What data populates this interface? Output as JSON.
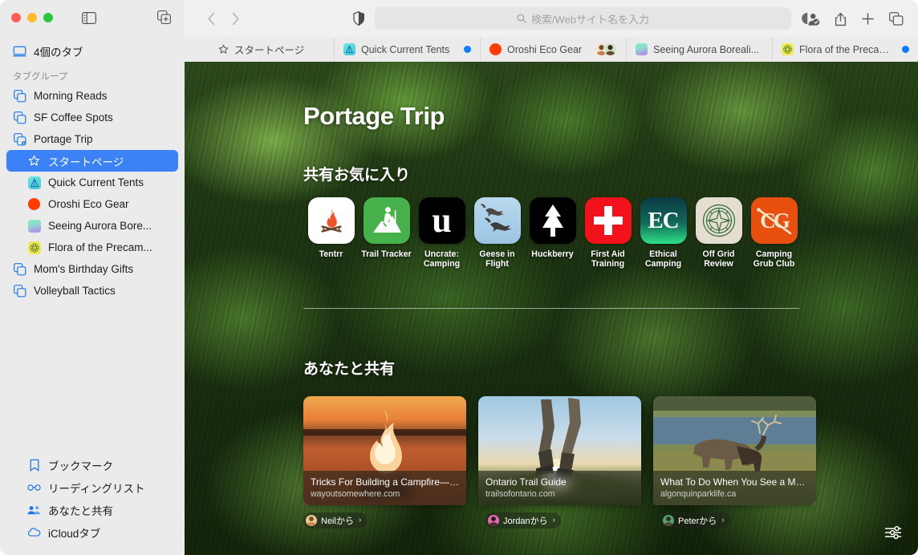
{
  "window": {
    "traffic_lights": [
      "close",
      "minimize",
      "zoom"
    ],
    "sidebar_toggle_icon": "sidebar-icon",
    "new_tab_group_icon": "new-tab-group-icon"
  },
  "sidebar": {
    "tabs_summary": {
      "label": "4個のタブ",
      "icon": "window-icon"
    },
    "section_label": "タブグループ",
    "groups": [
      {
        "label": "Morning Reads",
        "icon": "tab-group-icon",
        "selected": false
      },
      {
        "label": "SF Coffee Spots",
        "icon": "tab-group-icon",
        "selected": false
      },
      {
        "label": "Portage Trip",
        "icon": "tab-group-shared-icon",
        "selected": false
      }
    ],
    "portage_children": [
      {
        "label": "スタートページ",
        "icon": "star-icon",
        "selected": true,
        "color": ""
      },
      {
        "label": "Quick Current Tents",
        "icon": "site-favicon",
        "selected": false,
        "color": "#55d6d6"
      },
      {
        "label": "Oroshi Eco Gear",
        "icon": "site-favicon",
        "selected": false,
        "color": "#ff3b00"
      },
      {
        "label": "Seeing Aurora Bore...",
        "icon": "site-favicon",
        "selected": false,
        "color": "#6fe3b5"
      },
      {
        "label": "Flora of the Precam...",
        "icon": "site-favicon",
        "selected": false,
        "color": "#eeea55"
      }
    ],
    "groups_after": [
      {
        "label": "Mom's Birthday Gifts",
        "icon": "tab-group-icon",
        "selected": false
      },
      {
        "label": "Volleyball Tactics",
        "icon": "tab-group-icon",
        "selected": false
      }
    ],
    "bottom_items": [
      {
        "label": "ブックマーク",
        "icon": "bookmark-icon"
      },
      {
        "label": "リーディングリスト",
        "icon": "glasses-icon"
      },
      {
        "label": "あなたと共有",
        "icon": "shared-with-you-icon"
      },
      {
        "label": "iCloudタブ",
        "icon": "icloud-icon"
      }
    ]
  },
  "toolbar": {
    "back_icon": "chevron-left-icon",
    "forward_icon": "chevron-right-icon",
    "shield_icon": "privacy-shield-icon",
    "search_placeholder": "検索/Webサイト名を入力",
    "search_value": "",
    "search_icon": "magnifier-icon",
    "right_buttons": [
      {
        "icon": "shared-with-you-person-icon",
        "label": "共有"
      },
      {
        "icon": "share-icon",
        "label": "共有"
      },
      {
        "icon": "plus-icon",
        "label": "新規タブ"
      },
      {
        "icon": "tab-overview-icon",
        "label": "タブ概要"
      }
    ]
  },
  "tabbar": {
    "start_page": {
      "label": "スタートページ",
      "icon": "star-icon"
    },
    "tabs": [
      {
        "title": "Quick Current Tents",
        "favicon_color": "#55d6d6",
        "favicon": "tent-icon",
        "dot": true,
        "avatars": []
      },
      {
        "title": "Oroshi Eco Gear",
        "favicon_color": "#ff3b00",
        "favicon": "circle-icon",
        "dot": false,
        "avatars": [
          {
            "name": "A",
            "bg": "#f3e4c8"
          },
          {
            "name": "B",
            "bg": "#cde8c2"
          }
        ]
      },
      {
        "title": "Seeing Aurora Boreali...",
        "favicon_color": "#6fe3b5",
        "favicon": "aurora-icon",
        "dot": false,
        "avatars": []
      },
      {
        "title": "Flora of the Precambi...",
        "favicon_color": "#eeea55",
        "favicon": "flower-icon",
        "dot": true,
        "avatars": []
      }
    ]
  },
  "start_page": {
    "title": "Portage Trip",
    "favorites_heading": "共有お気に入り",
    "favorites": [
      {
        "name": "Tentrr",
        "icon": "campfire-icon",
        "bg": "#ffffff",
        "fg": "#f0532a"
      },
      {
        "name": "Trail Tracker",
        "icon": "hiker-icon",
        "bg": "#47b14b",
        "fg": "#ffffff"
      },
      {
        "name": "Uncrate: Camping",
        "icon": "letter-u-icon",
        "bg": "#000000",
        "fg": "#ffffff"
      },
      {
        "name": "Geese in Flight",
        "icon": "geese-icon",
        "bg": "#a8cbe6",
        "fg": "#3b3b3b"
      },
      {
        "name": "Huckberry",
        "icon": "pine-tree-icon",
        "bg": "#000000",
        "fg": "#ffffff"
      },
      {
        "name": "First Aid Training",
        "icon": "red-cross-icon",
        "bg": "#f1121b",
        "fg": "#ffffff"
      },
      {
        "name": "Ethical Camping",
        "icon": "letters-ec-icon",
        "bg": "#0d3b33",
        "fg": "#ffffff"
      },
      {
        "name": "Off Grid Review",
        "icon": "compass-icon",
        "bg": "#e5ddd0",
        "fg": "#2e6b34"
      },
      {
        "name": "Camping Grub Club",
        "icon": "letters-cg-icon",
        "bg": "#e8500f",
        "fg": "#f2e7cf"
      }
    ],
    "shared_heading": "あなたと共有",
    "shared_cards": [
      {
        "title": "Tricks For Building a Campfire—F...",
        "url": "wayoutsomewhere.com",
        "from_label": "Neilから",
        "from_avatar_bg": "#e7c98f",
        "image": "campfire-at-sunset-photo"
      },
      {
        "title": "Ontario Trail Guide",
        "url": "trailsofontario.com",
        "from_label": "Jordanから",
        "from_avatar_bg": "#e46bb0",
        "image": "hiker-legs-at-sunrise-photo"
      },
      {
        "title": "What To Do When You See a Moo...",
        "url": "algonquinparklife.ca",
        "from_label": "Peterから",
        "from_avatar_bg": "#4ea36b",
        "image": "moose-grazing-by-lake-photo"
      }
    ],
    "settings_button": {
      "icon": "sliders-icon",
      "label": "スタートページをカスタマイズ"
    }
  },
  "colors": {
    "accent": "#3b82f6",
    "tab_dot": "#0a7cff",
    "sidebar_bg": "#ebebeb",
    "toolbar_bg": "#f0f0f0"
  }
}
